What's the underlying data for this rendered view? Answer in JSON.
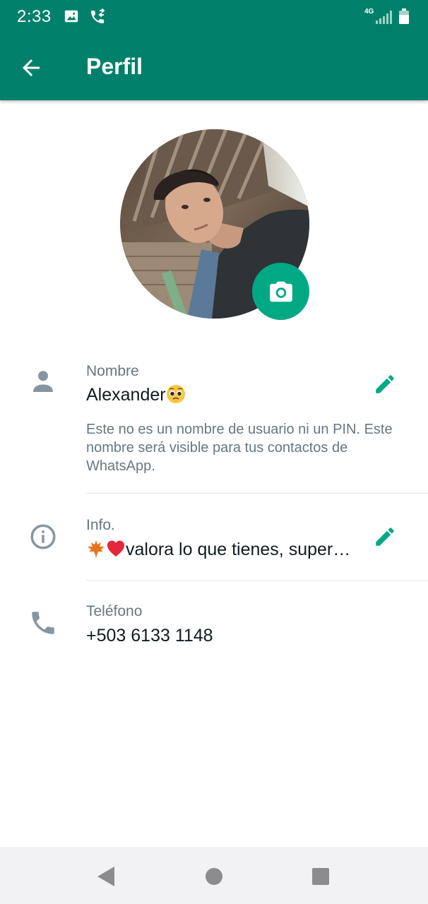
{
  "status_bar": {
    "time": "2:33",
    "network": "4G",
    "icons": [
      "gallery-icon",
      "call-icon",
      "signal-icon",
      "battery-icon"
    ]
  },
  "app_bar": {
    "title": "Perfil",
    "back_icon": "arrow-back-icon"
  },
  "profile": {
    "photo": "profile-photo",
    "camera_icon": "camera-icon"
  },
  "name_row": {
    "label": "Nombre",
    "value": "Alexander",
    "help": "Este no es un nombre de usuario ni un PIN. Este nombre será visible para tus contactos de WhatsApp.",
    "icon": "person-icon",
    "edit_icon": "pencil-icon"
  },
  "info_row": {
    "label": "Info.",
    "value": "valora lo que tienes, super…",
    "icon": "info-icon",
    "edit_icon": "pencil-icon"
  },
  "phone_row": {
    "label": "Teléfono",
    "value": "+503 6133 1148",
    "icon": "phone-icon"
  },
  "nav": {
    "items": [
      "nav-back-icon",
      "nav-home-icon",
      "nav-recent-icon"
    ]
  },
  "colors": {
    "primary": "#00806a",
    "accent": "#00a884",
    "text_primary": "#111b21",
    "text_secondary": "#667781",
    "icon_gray": "#8696a0"
  }
}
